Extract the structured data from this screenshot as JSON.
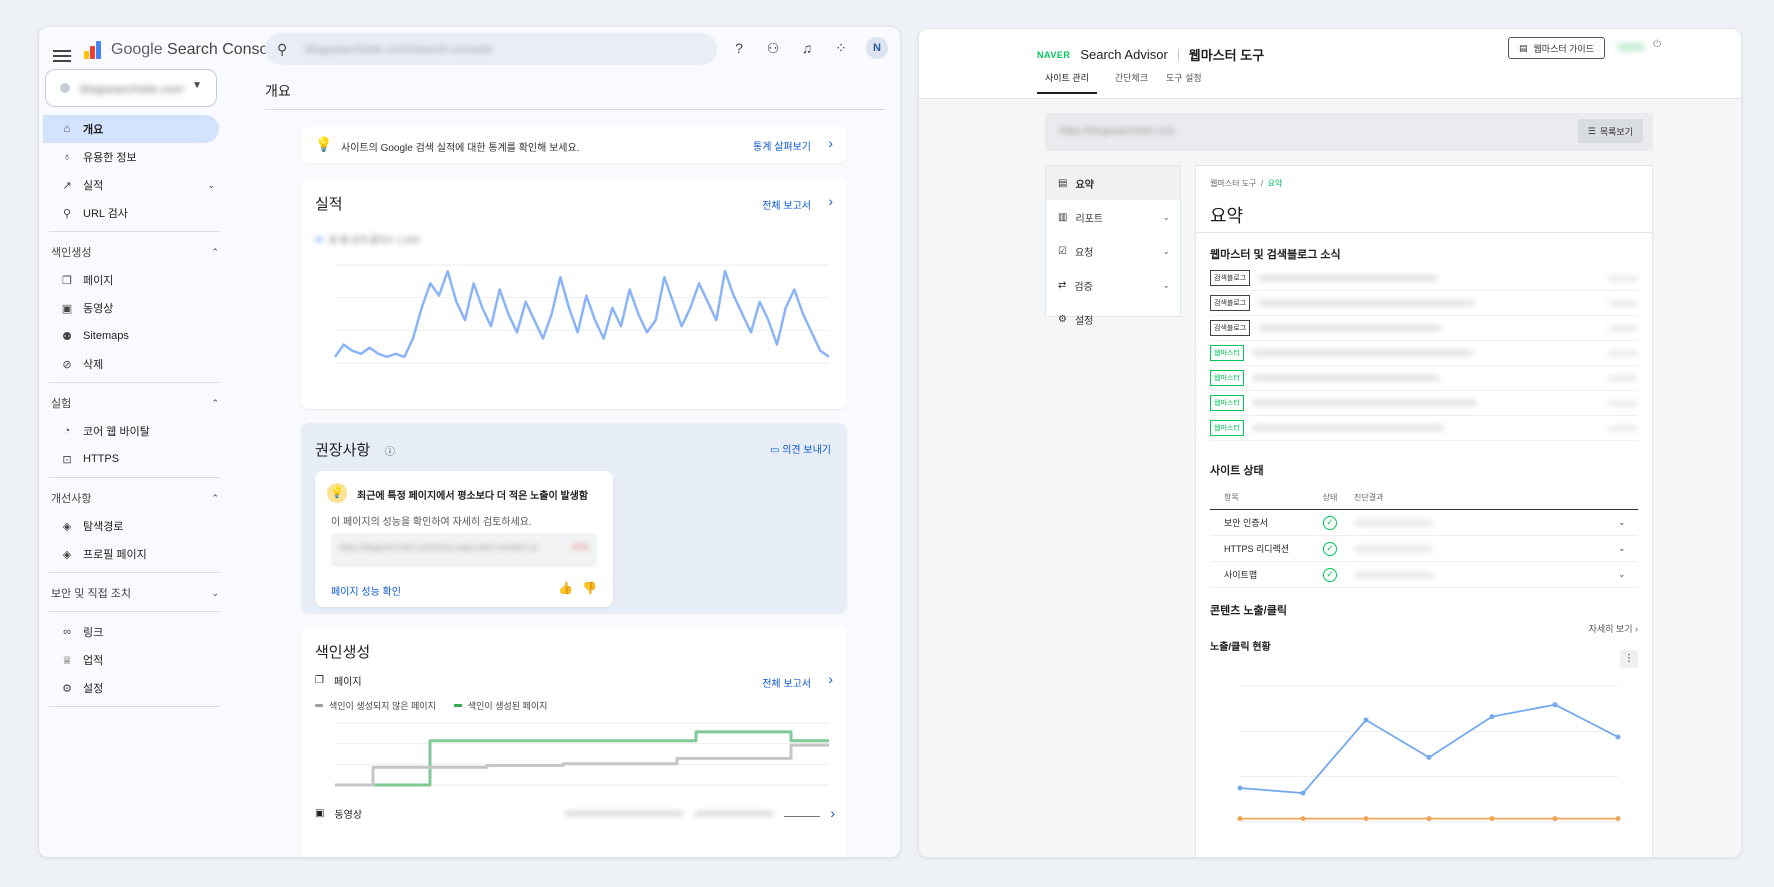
{
  "gsc": {
    "brand_google": "Google",
    "brand_product": "Search Console",
    "search_placeholder": "blogsearchsite.com/search-console",
    "property": "blogsearchsite.com",
    "page_title": "개요",
    "sidebar": [
      {
        "type": "item",
        "label": "개요",
        "icon": "home-icon",
        "glyph": "⌂",
        "active": true
      },
      {
        "type": "item",
        "label": "유용한 정보",
        "icon": "lightbulb-icon",
        "glyph": "♁"
      },
      {
        "type": "item",
        "label": "실적",
        "icon": "trend-icon",
        "glyph": "↗",
        "chevron": "⌄"
      },
      {
        "type": "item",
        "label": "URL 검사",
        "icon": "search-icon",
        "glyph": "⚲"
      },
      {
        "type": "divider"
      },
      {
        "type": "group",
        "label": "색인생성",
        "chevron": "⌃"
      },
      {
        "type": "item",
        "label": "페이지",
        "icon": "pages-icon",
        "glyph": "❐"
      },
      {
        "type": "item",
        "label": "동영상",
        "icon": "video-icon",
        "glyph": "▣"
      },
      {
        "type": "item",
        "label": "Sitemaps",
        "icon": "sitemap-icon",
        "glyph": "⚉"
      },
      {
        "type": "item",
        "label": "삭제",
        "icon": "removal-icon",
        "glyph": "⊘"
      },
      {
        "type": "divider"
      },
      {
        "type": "group",
        "label": "실험",
        "chevron": "⌃"
      },
      {
        "type": "item",
        "label": "코어 웹 바이탈",
        "icon": "gauge-icon",
        "glyph": "◔"
      },
      {
        "type": "item",
        "label": "HTTPS",
        "icon": "lock-icon",
        "glyph": "⊡"
      },
      {
        "type": "divider"
      },
      {
        "type": "group",
        "label": "개선사항",
        "chevron": "⌃"
      },
      {
        "type": "item",
        "label": "탐색경로",
        "icon": "layers-icon",
        "glyph": "◈"
      },
      {
        "type": "item",
        "label": "프로필 페이지",
        "icon": "layers-icon",
        "glyph": "◈"
      },
      {
        "type": "divider"
      },
      {
        "type": "group",
        "label": "보안 및 직접 조치",
        "chevron": "⌄"
      },
      {
        "type": "divider"
      },
      {
        "type": "item",
        "label": "링크",
        "icon": "link-icon",
        "glyph": "∞"
      },
      {
        "type": "item",
        "label": "업적",
        "icon": "trophy-icon",
        "glyph": "♕"
      },
      {
        "type": "item",
        "label": "설정",
        "icon": "settings-icon",
        "glyph": "⚙"
      },
      {
        "type": "divider"
      }
    ],
    "insight_banner": {
      "text": "사이트의 Google 검색 실적에 대한 통계를 확인해 보세요.",
      "link": "통계 살펴보기"
    },
    "performance": {
      "title": "실적",
      "link": "전체 보고서",
      "legend": "총 웹 검색 클릭수 1,000"
    },
    "recommendations": {
      "title": "권장사항",
      "feedback": "의견 보내기",
      "card_title": "최근에 특정 페이지에서 평소보다 더 적은 노출이 발생함",
      "card_desc": "이 페이지의 성능을 확인하여 자세히 검토하세요.",
      "card_url": "https://blogsearchsite.com/some-page-path-example-content-report",
      "card_pct": "-97%",
      "card_link": "페이지 성능 확인"
    },
    "indexing": {
      "title": "색인생성",
      "sub": "페이지",
      "link": "전체 보고서",
      "legend_not": "색인이 생성되지 않은 페이지",
      "legend_yes": "색인이 생성된 페이지",
      "video_label": "동영상"
    },
    "colors": {
      "accent": "#0b57d0",
      "series": "#4285f4",
      "indexed": "#34a853",
      "not_indexed": "#9e9e9e"
    }
  },
  "naver": {
    "brand": "NAVER",
    "product": "Search Advisor",
    "title": "웹마스터 도구",
    "guide": "웹마스터 가이드",
    "tabs": [
      "사이트 관리",
      "간단체크",
      "도구 설정"
    ],
    "site_url": "https://blogsearchsite.com",
    "list_btn": "목록보기",
    "side": [
      {
        "label": "요약",
        "glyph": "▤",
        "icon": "clipboard-icon",
        "active": true
      },
      {
        "label": "리포트",
        "glyph": "▥",
        "icon": "report-icon",
        "chev": "⌄"
      },
      {
        "label": "요청",
        "glyph": "☑",
        "icon": "request-icon",
        "chev": "⌄"
      },
      {
        "label": "검증",
        "glyph": "⇄",
        "icon": "verify-icon",
        "chev": "⌄"
      },
      {
        "label": "설정",
        "glyph": "⚙",
        "icon": "settings-icon"
      }
    ],
    "breadcrumb": [
      "웹마스터 도구",
      "요약"
    ],
    "page_title": "요약",
    "news_title": "웹마스터 및 검색블로그 소식",
    "news": [
      {
        "tag": "검색블로그",
        "green": false
      },
      {
        "tag": "검색블로그",
        "green": false
      },
      {
        "tag": "검색블로그",
        "green": false
      },
      {
        "tag": "웹마스터",
        "green": true
      },
      {
        "tag": "웹마스터",
        "green": true
      },
      {
        "tag": "웹마스터",
        "green": true
      },
      {
        "tag": "웹마스터",
        "green": true
      }
    ],
    "status_title": "사이트 상태",
    "status_head": [
      "항목",
      "상태",
      "진단결과"
    ],
    "status": [
      {
        "item": "보안 인증서"
      },
      {
        "item": "HTTPS 리디렉션"
      },
      {
        "item": "사이트맵"
      }
    ],
    "content_title": "콘텐츠 노출/클릭",
    "more": "자세히 보기",
    "chart_title": "노출/클릭 현황"
  },
  "chart_data": [
    {
      "type": "line",
      "title": "",
      "series": [
        {
          "name": "",
          "values": [
            2,
            6,
            4,
            3,
            5,
            3,
            2,
            3,
            2,
            8,
            18,
            26,
            22,
            30,
            20,
            14,
            26,
            18,
            12,
            24,
            16,
            10,
            20,
            14,
            8,
            16,
            28,
            18,
            10,
            22,
            14,
            8,
            18,
            12,
            24,
            16,
            10,
            14,
            28,
            20,
            12,
            18,
            26,
            20,
            14,
            30,
            22,
            16,
            10,
            20,
            14,
            6,
            18,
            24,
            16,
            10,
            4,
            2
          ]
        }
      ],
      "ylim": [
        0,
        32
      ]
    },
    {
      "type": "line",
      "title": "",
      "series": [
        {
          "name": "색인이 생성된 페이지",
          "values": [
            0,
            0,
            0,
            0,
            0,
            5,
            5,
            5,
            5,
            5,
            5,
            5,
            5,
            5,
            5,
            5,
            5,
            5,
            5,
            6,
            6,
            6,
            6,
            6,
            5,
            5,
            5
          ]
        },
        {
          "name": "색인이 생성되지 않은 페이지",
          "values": [
            0,
            0,
            2,
            2,
            2,
            2,
            2,
            2,
            2.2,
            2.2,
            2.2,
            2.2,
            2.4,
            2.4,
            2.4,
            2.4,
            2.4,
            2.4,
            3,
            3,
            3,
            3,
            3,
            3,
            4.5,
            4.5,
            4.5
          ]
        }
      ],
      "ylim": [
        0,
        7
      ]
    },
    {
      "type": "line",
      "title": "",
      "series": [
        {
          "name": "",
          "values": [
            20,
            17,
            60,
            38,
            62,
            69,
            50
          ]
        },
        {
          "name": "",
          "values": [
            2,
            2,
            2,
            2,
            2,
            2,
            2
          ]
        }
      ],
      "ylim": [
        0,
        80
      ]
    }
  ]
}
